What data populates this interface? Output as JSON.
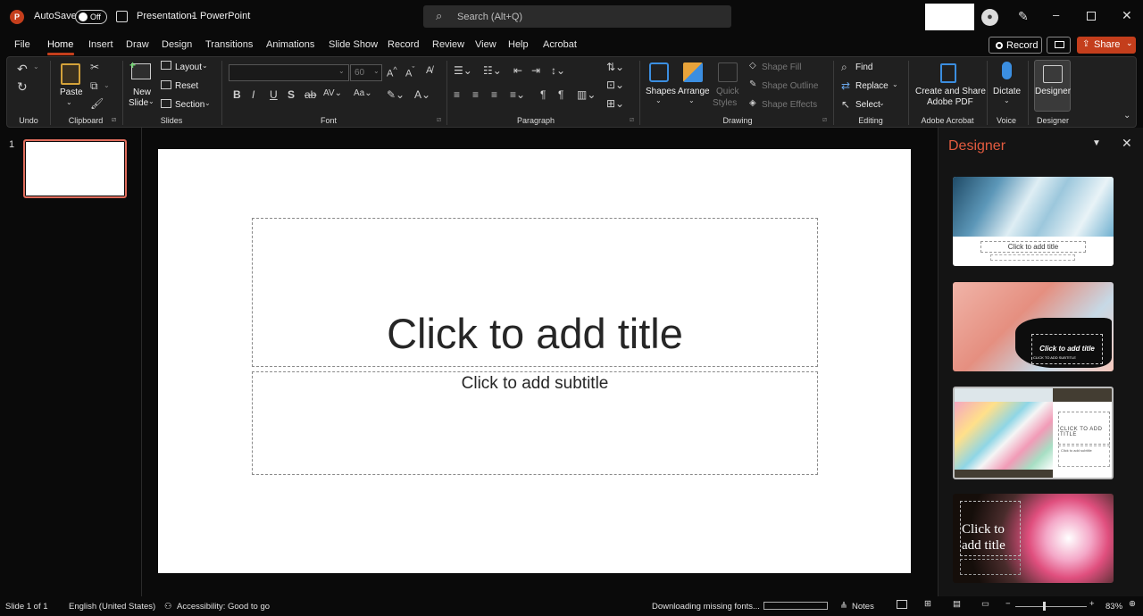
{
  "titlebar": {
    "autosave_label": "AutoSave",
    "autosave_state": "Off",
    "doc_title": "Presentation1",
    "app_sep": "-",
    "app_name": "PowerPoint",
    "search_placeholder": "Search (Alt+Q)"
  },
  "menu": {
    "items": [
      "File",
      "Home",
      "Insert",
      "Draw",
      "Design",
      "Transitions",
      "Animations",
      "Slide Show",
      "Record",
      "Review",
      "View",
      "Help",
      "Acrobat"
    ],
    "active": "Home"
  },
  "actions": {
    "record": "Record",
    "share": "Share"
  },
  "ribbon": {
    "groups": {
      "undo": "Undo",
      "clipboard": "Clipboard",
      "slides": "Slides",
      "font": "Font",
      "paragraph": "Paragraph",
      "drawing": "Drawing",
      "editing": "Editing",
      "acrobat": "Adobe Acrobat",
      "voice": "Voice",
      "designer": "Designer"
    },
    "paste": "Paste",
    "new_slide_1": "New",
    "new_slide_2": "Slide",
    "layout": "Layout",
    "reset": "Reset",
    "section": "Section",
    "font_name": "",
    "font_size": "60",
    "shapes": "Shapes",
    "arrange": "Arrange",
    "quick_styles_1": "Quick",
    "quick_styles_2": "Styles",
    "shape_fill": "Shape Fill",
    "shape_outline": "Shape Outline",
    "shape_effects": "Shape Effects",
    "find": "Find",
    "replace": "Replace",
    "select": "Select",
    "create_share_1": "Create and Share",
    "create_share_2": "Adobe PDF",
    "dictate": "Dictate",
    "designer_btn": "Designer"
  },
  "thumbnails": {
    "slide_number": "1"
  },
  "slide": {
    "title_placeholder": "Click to add title",
    "subtitle_placeholder": "Click to add subtitle"
  },
  "designer": {
    "title": "Designer",
    "t1_title": "Click to add title",
    "t2_title": "Click to add title",
    "t2_sub": "CLICK TO ADD SUBTITLE",
    "t3_title": "CLICK TO ADD TITLE",
    "t3_sub": "Click to add subtitle",
    "t4_title_1": "Click to",
    "t4_title_2": "add title"
  },
  "status": {
    "slide_info": "Slide 1 of 1",
    "language": "English (United States)",
    "accessibility": "Accessibility: Good to go",
    "downloading": "Downloading missing fonts...",
    "notes": "Notes",
    "zoom": "83%"
  },
  "colors": {
    "accent": "#c43e1c",
    "ppt_logo": "#c43e1c",
    "slide_selected": "#e06c5c"
  }
}
